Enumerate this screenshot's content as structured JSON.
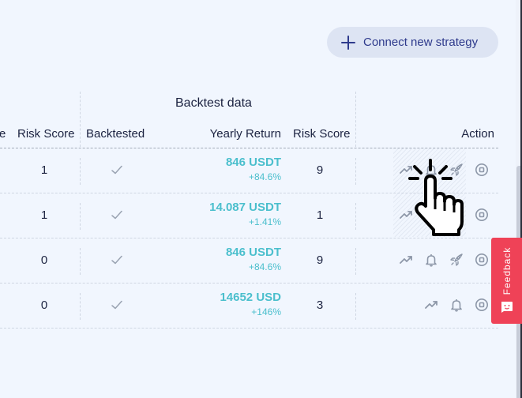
{
  "toolbar": {
    "connect_button_label": "Connect new strategy",
    "connect_button_icon": "plus-icon"
  },
  "table": {
    "group_header": "Backtest data",
    "columns": {
      "partial_prev": "e",
      "risk_score": "Risk Score",
      "backtested": "Backtested",
      "yearly_return": "Yearly Return",
      "backtest_risk_score": "Risk Score",
      "action": "Action"
    },
    "rows": [
      {
        "risk_score": "1",
        "backtested": true,
        "yearly_return": "846 USDT",
        "yearly_return_pct": "+84.6%",
        "backtest_risk_score": "9",
        "actions": [
          "trend-icon",
          "bell-icon",
          "rocket-icon",
          "stop-icon"
        ]
      },
      {
        "risk_score": "1",
        "backtested": true,
        "yearly_return": "14.087 USDT",
        "yearly_return_pct": "+1.41%",
        "backtest_risk_score": "1",
        "actions": [
          "trend-icon",
          "bell-icon",
          "rocket-icon",
          "stop-icon"
        ]
      },
      {
        "risk_score": "0",
        "backtested": true,
        "yearly_return": "846 USDT",
        "yearly_return_pct": "+84.6%",
        "backtest_risk_score": "9",
        "actions": [
          "trend-icon",
          "bell-icon",
          "rocket-icon",
          "stop-icon"
        ]
      },
      {
        "risk_score": "0",
        "backtested": true,
        "yearly_return": "14652 USD",
        "yearly_return_pct": "+146%",
        "backtest_risk_score": "3",
        "actions": [
          "trend-icon",
          "bell-icon",
          "stop-icon"
        ]
      }
    ]
  },
  "feedback": {
    "label": "Feedback"
  },
  "colors": {
    "accent_return": "#4bbfcd",
    "button_bg": "#dde4f3",
    "button_text": "#2e3a8c",
    "feedback_bg": "#ef4257",
    "icon_gray": "#8d97a8"
  }
}
